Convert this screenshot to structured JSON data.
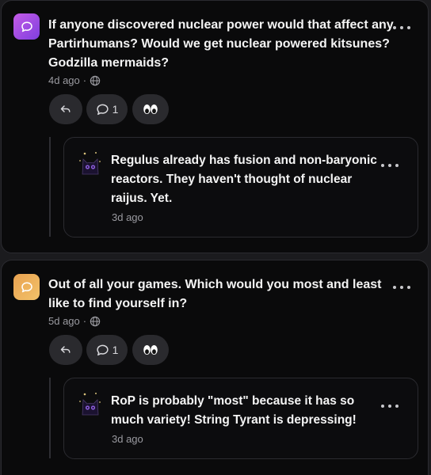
{
  "posts": [
    {
      "question": "If anyone discovered nuclear power would that affect any Partirhumans? Would we get nuclear powered kitsunes? Godzilla mermaids?",
      "time": "4d ago",
      "separator": "·",
      "comment_count": "1",
      "avatar_color": "#a24fe4",
      "reply": {
        "text": "Regulus already has fusion and non-baryonic reactors. They haven't thought of nuclear raijus. Yet.",
        "time": "3d ago"
      }
    },
    {
      "question": "Out of all your games. Which would you most and least like to find yourself in?",
      "time": "5d ago",
      "separator": "·",
      "comment_count": "1",
      "avatar_color": "#eeb45f",
      "reply": {
        "text": "RoP is probably \"most\" because it has so much variety! String Tyrant is depressing!",
        "time": "3d ago"
      }
    }
  ],
  "icons": {
    "avatar": "speech-bubble-icon",
    "visibility": "globe-icon",
    "reply": "reply-arrow-icon",
    "comments": "comment-icon",
    "reaction": "eyes-icon",
    "menu": "more-dots-icon",
    "reply_avatar": "cat-avatar"
  }
}
